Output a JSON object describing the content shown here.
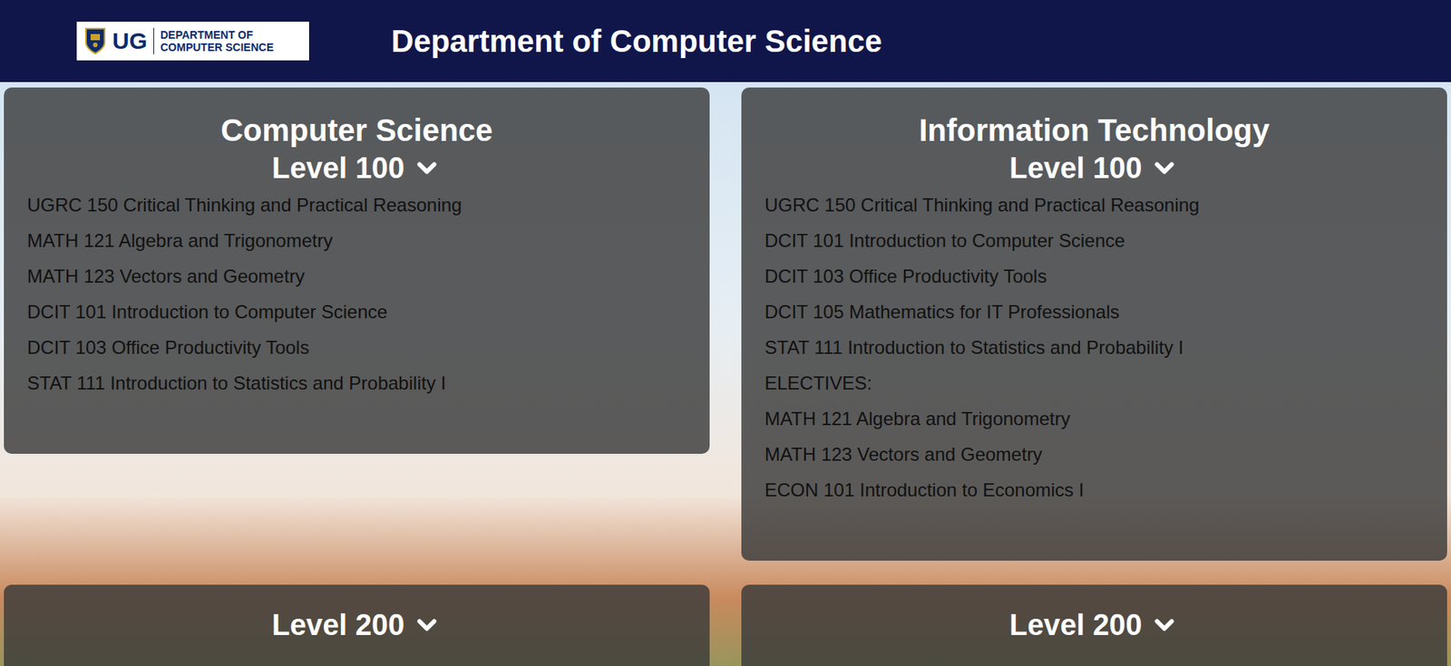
{
  "header": {
    "logo": {
      "abbr": "UG",
      "line1": "DEPARTMENT OF",
      "line2": "COMPUTER SCIENCE"
    },
    "title": "Department of Computer Science"
  },
  "programs": [
    {
      "name": "Computer Science",
      "levels": [
        {
          "label": "Level 100",
          "courses": [
            {
              "kind": "course",
              "text": "UGRC 150 Critical Thinking and Practical Reasoning"
            },
            {
              "kind": "course",
              "text": "MATH 121 Algebra and Trigonometry"
            },
            {
              "kind": "course",
              "text": "MATH 123 Vectors and Geometry"
            },
            {
              "kind": "course",
              "text": "DCIT 101 Introduction to Computer Science"
            },
            {
              "kind": "course",
              "text": "DCIT 103 Office Productivity Tools"
            },
            {
              "kind": "course",
              "text": "STAT 111 Introduction to Statistics and Probability I"
            }
          ]
        },
        {
          "label": "Level 200",
          "courses": []
        }
      ]
    },
    {
      "name": "Information Technology",
      "levels": [
        {
          "label": "Level 100",
          "courses": [
            {
              "kind": "course",
              "text": "UGRC 150 Critical Thinking and Practical Reasoning"
            },
            {
              "kind": "course",
              "text": "DCIT 101 Introduction to Computer Science"
            },
            {
              "kind": "course",
              "text": "DCIT 103 Office Productivity Tools"
            },
            {
              "kind": "course",
              "text": "DCIT 105 Mathematics for IT Professionals"
            },
            {
              "kind": "course",
              "text": "STAT 111 Introduction to Statistics and Probability I"
            },
            {
              "kind": "heading",
              "text": "ELECTIVES:"
            },
            {
              "kind": "course",
              "text": "MATH 121 Algebra and Trigonometry"
            },
            {
              "kind": "course",
              "text": "MATH 123 Vectors and Geometry"
            },
            {
              "kind": "course",
              "text": "ECON 101 Introduction to Economics I"
            }
          ]
        },
        {
          "label": "Level 200",
          "courses": []
        }
      ]
    }
  ]
}
